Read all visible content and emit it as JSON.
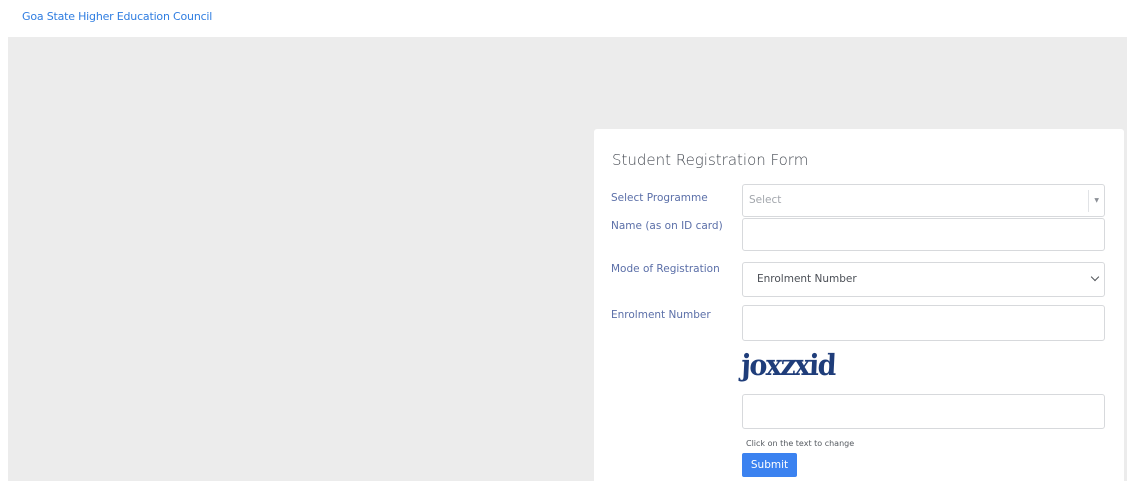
{
  "header": {
    "brand": "Goa State Higher Education Council"
  },
  "form": {
    "title": "Student Registration Form",
    "programme": {
      "label": "Select Programme",
      "placeholder": "Select"
    },
    "name": {
      "label": "Name (as on ID card)",
      "value": ""
    },
    "mode": {
      "label": "Mode of Registration",
      "selected": "Enrolment Number"
    },
    "enrolment": {
      "label": "Enrolment Number",
      "value": ""
    },
    "captcha": {
      "text": "joxzxid",
      "input_value": "",
      "hint": "Click on the text to change"
    },
    "submit_label": "Submit"
  },
  "colors": {
    "brand_link": "#2f7de1",
    "label": "#5b6fa8",
    "captcha": "#1f3d7a",
    "submit_bg": "#3b82f0",
    "page_bg": "#ececec"
  },
  "icons": {
    "programme_dropdown": "caret-down-icon",
    "mode_dropdown": "chevron-down-icon"
  }
}
